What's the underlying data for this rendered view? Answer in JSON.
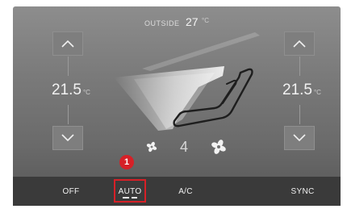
{
  "outside": {
    "label": "OUTSIDE",
    "value": "27",
    "unit": "°C"
  },
  "left_zone": {
    "temperature": "21.5",
    "unit": "°C"
  },
  "right_zone": {
    "temperature": "21.5",
    "unit": "°C"
  },
  "fan": {
    "level": "4"
  },
  "bottom_bar": {
    "off": "OFF",
    "auto": "AUTO",
    "ac": "A/C",
    "sync": "SYNC"
  },
  "callout": {
    "number": "1"
  },
  "colors": {
    "highlight": "#d62027",
    "panel": "#7a7a7a",
    "bar": "#3a3a3a"
  },
  "icons": [
    "chevron-up-icon",
    "chevron-down-icon",
    "fan-small-icon",
    "fan-large-icon",
    "seat-airflow-icon"
  ]
}
